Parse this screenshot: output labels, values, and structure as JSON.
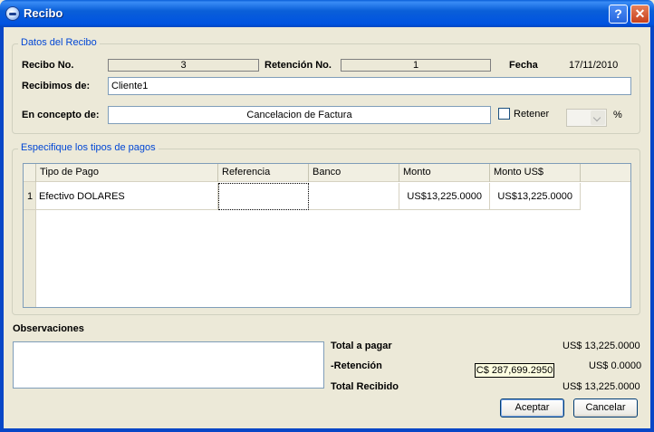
{
  "window": {
    "title": "Recibo",
    "help_glyph": "?",
    "close_glyph": "✕"
  },
  "datos": {
    "legend": "Datos del Recibo",
    "recibo_label": "Recibo No.",
    "recibo_value": "3",
    "retencion_label": "Retención No.",
    "retencion_value": "1",
    "fecha_label": "Fecha",
    "fecha_value": "17/11/2010",
    "recibimos_label": "Recibimos de:",
    "recibimos_value": "Cliente1",
    "concepto_label": "En concepto de:",
    "concepto_value": "Cancelacion de Factura",
    "retener_label": "Retener",
    "percent_label": "%"
  },
  "pagos": {
    "legend": "Especifique los tipos de pagos",
    "columns": [
      "Tipo de Pago",
      "Referencia",
      "Banco",
      "Monto",
      "Monto US$"
    ],
    "rows": [
      {
        "num": "1",
        "tipo": "Efectivo DOLARES",
        "referencia": "",
        "banco": "",
        "monto": "US$13,225.0000",
        "monto_us": "US$13,225.0000"
      }
    ]
  },
  "observaciones": {
    "label": "Observaciones",
    "value": ""
  },
  "totales": {
    "total_pagar_label": "Total a pagar",
    "total_pagar_value": "US$ 13,225.0000",
    "retencion_label": "-Retención",
    "retencion_value": "US$ 0.0000",
    "total_recibido_label": "Total Recibido",
    "total_recibido_value": "US$ 13,225.0000"
  },
  "tooltip": "C$ 287,699.2950",
  "buttons": {
    "aceptar": "Aceptar",
    "cancelar": "Cancelar"
  }
}
